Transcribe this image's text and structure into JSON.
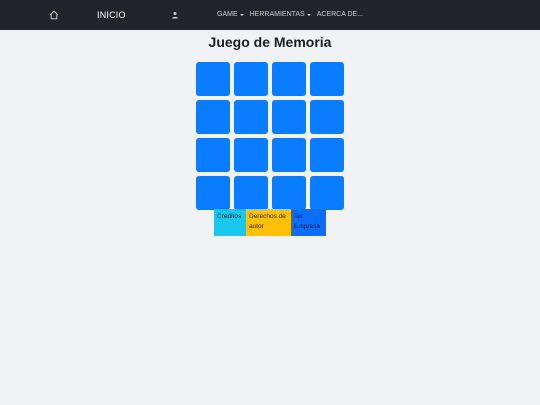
{
  "navbar": {
    "brand": "INICIO",
    "menu": [
      {
        "label": "GAME",
        "dropdown": true
      },
      {
        "label": "HERRAMIENTAS",
        "dropdown": true
      },
      {
        "label": "ACERCA DE...",
        "dropdown": false
      }
    ],
    "icons": {
      "home": "home-icon",
      "user": "user-icon"
    }
  },
  "main": {
    "title": "Juego de Memoria",
    "card_count": 16,
    "card_color": "#0a7cff"
  },
  "footer": {
    "creditos": "Creditos",
    "derechos": "Derechos de autor",
    "tel": "Tel: Empresa"
  },
  "colors": {
    "navbar_bg": "#212529",
    "page_bg": "#f1f2f6",
    "creditos_bg": "#1ac8ef",
    "derechos_bg": "#ffc107",
    "tel_bg": "#0d6efd"
  }
}
